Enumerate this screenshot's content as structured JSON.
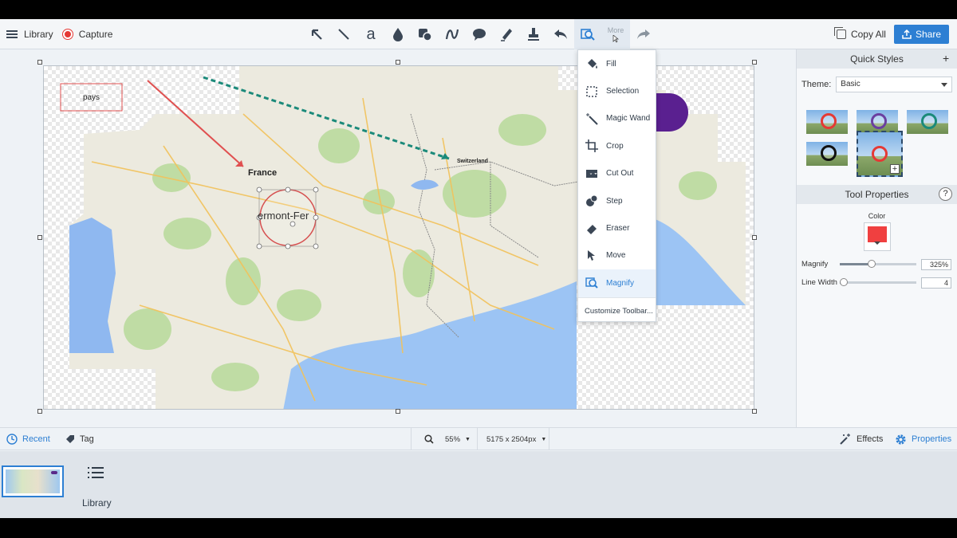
{
  "toolbar": {
    "library_label": "Library",
    "capture_label": "Capture",
    "more_label": "More",
    "copy_all_label": "Copy All",
    "share_label": "Share",
    "tools": [
      {
        "name": "arrow-tool",
        "icon": "arrow-icon"
      },
      {
        "name": "line-tool",
        "icon": "line-icon"
      },
      {
        "name": "text-tool",
        "icon": "text-icon"
      },
      {
        "name": "callout-tool",
        "icon": "drop-icon"
      },
      {
        "name": "shape-tool",
        "icon": "shape-icon"
      },
      {
        "name": "pen-tool",
        "icon": "curve-icon"
      },
      {
        "name": "speech-tool",
        "icon": "speech-bubble-icon"
      },
      {
        "name": "highlighter-tool",
        "icon": "highlighter-icon"
      },
      {
        "name": "stamp-tool",
        "icon": "stamp-icon"
      },
      {
        "name": "undo",
        "icon": "undo-icon"
      },
      {
        "name": "magnify-tool",
        "icon": "magnify-icon"
      }
    ]
  },
  "canvas": {
    "labels": {
      "pays": "pays",
      "france": "France",
      "switzerland": "Switzerland",
      "clermont": "ermont-Fer"
    }
  },
  "more_menu": {
    "items": [
      {
        "label": "Fill",
        "icon": "fill-bucket-icon"
      },
      {
        "label": "Selection",
        "icon": "selection-icon"
      },
      {
        "label": "Magic Wand",
        "icon": "magic-wand-icon"
      },
      {
        "label": "Crop",
        "icon": "crop-icon"
      },
      {
        "label": "Cut Out",
        "icon": "cut-out-icon"
      },
      {
        "label": "Step",
        "icon": "step-icon"
      },
      {
        "label": "Eraser",
        "icon": "eraser-icon"
      },
      {
        "label": "Move",
        "icon": "move-icon"
      },
      {
        "label": "Magnify",
        "icon": "magnify-icon",
        "selected": true
      }
    ],
    "customize_label": "Customize Toolbar..."
  },
  "quick_styles": {
    "title": "Quick Styles",
    "theme_label": "Theme:",
    "theme_value": "Basic",
    "styles": [
      {
        "ring_color": "#e53935"
      },
      {
        "ring_color": "#6a3fa0"
      },
      {
        "ring_color": "#1b8a7a"
      },
      {
        "ring_color": "#111111"
      },
      {
        "ring_color": "#e53935"
      }
    ]
  },
  "tool_properties": {
    "title": "Tool Properties",
    "help_label": "?",
    "color_label": "Color",
    "color_value": "#f04040",
    "magnify_label": "Magnify",
    "magnify_value": "325%",
    "magnify_fraction": 0.42,
    "line_width_label": "Line Width",
    "line_width_value": "4",
    "line_width_fraction": 0.05
  },
  "bottom_bar": {
    "recent_label": "Recent",
    "tag_label": "Tag",
    "zoom_value": "55%",
    "dimensions_value": "5175 x 2504px",
    "effects_label": "Effects",
    "properties_label": "Properties"
  },
  "tray": {
    "library_label": "Library"
  },
  "colors": {
    "accent": "#2d7fd3",
    "record": "#e53935",
    "annotation_red": "#e05050",
    "annotation_teal": "#1b8a7a",
    "shape_purple": "#5a2090"
  }
}
